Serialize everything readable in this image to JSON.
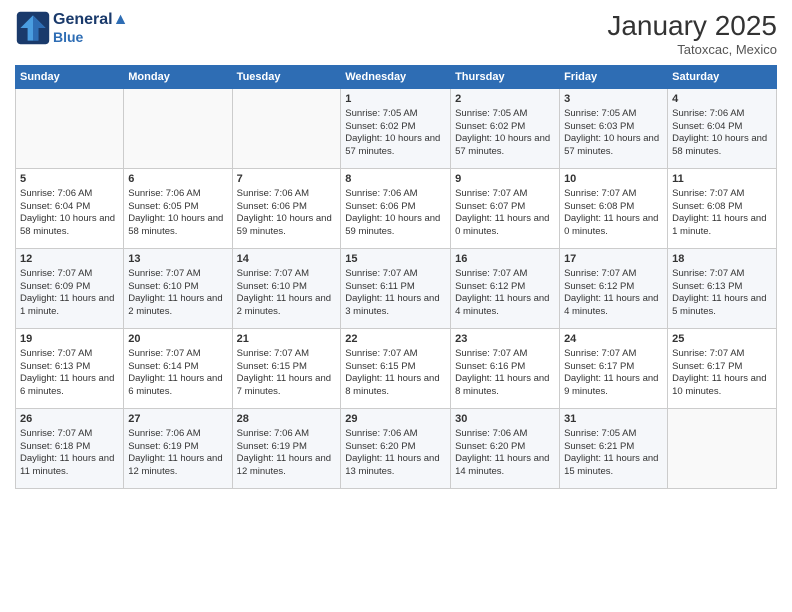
{
  "header": {
    "logo_line1": "General",
    "logo_line2": "Blue",
    "month_title": "January 2025",
    "location": "Tatoxcac, Mexico"
  },
  "weekdays": [
    "Sunday",
    "Monday",
    "Tuesday",
    "Wednesday",
    "Thursday",
    "Friday",
    "Saturday"
  ],
  "weeks": [
    [
      {
        "day": "",
        "info": ""
      },
      {
        "day": "",
        "info": ""
      },
      {
        "day": "",
        "info": ""
      },
      {
        "day": "1",
        "info": "Sunrise: 7:05 AM\nSunset: 6:02 PM\nDaylight: 10 hours and 57 minutes."
      },
      {
        "day": "2",
        "info": "Sunrise: 7:05 AM\nSunset: 6:02 PM\nDaylight: 10 hours and 57 minutes."
      },
      {
        "day": "3",
        "info": "Sunrise: 7:05 AM\nSunset: 6:03 PM\nDaylight: 10 hours and 57 minutes."
      },
      {
        "day": "4",
        "info": "Sunrise: 7:06 AM\nSunset: 6:04 PM\nDaylight: 10 hours and 58 minutes."
      }
    ],
    [
      {
        "day": "5",
        "info": "Sunrise: 7:06 AM\nSunset: 6:04 PM\nDaylight: 10 hours and 58 minutes."
      },
      {
        "day": "6",
        "info": "Sunrise: 7:06 AM\nSunset: 6:05 PM\nDaylight: 10 hours and 58 minutes."
      },
      {
        "day": "7",
        "info": "Sunrise: 7:06 AM\nSunset: 6:06 PM\nDaylight: 10 hours and 59 minutes."
      },
      {
        "day": "8",
        "info": "Sunrise: 7:06 AM\nSunset: 6:06 PM\nDaylight: 10 hours and 59 minutes."
      },
      {
        "day": "9",
        "info": "Sunrise: 7:07 AM\nSunset: 6:07 PM\nDaylight: 11 hours and 0 minutes."
      },
      {
        "day": "10",
        "info": "Sunrise: 7:07 AM\nSunset: 6:08 PM\nDaylight: 11 hours and 0 minutes."
      },
      {
        "day": "11",
        "info": "Sunrise: 7:07 AM\nSunset: 6:08 PM\nDaylight: 11 hours and 1 minute."
      }
    ],
    [
      {
        "day": "12",
        "info": "Sunrise: 7:07 AM\nSunset: 6:09 PM\nDaylight: 11 hours and 1 minute."
      },
      {
        "day": "13",
        "info": "Sunrise: 7:07 AM\nSunset: 6:10 PM\nDaylight: 11 hours and 2 minutes."
      },
      {
        "day": "14",
        "info": "Sunrise: 7:07 AM\nSunset: 6:10 PM\nDaylight: 11 hours and 2 minutes."
      },
      {
        "day": "15",
        "info": "Sunrise: 7:07 AM\nSunset: 6:11 PM\nDaylight: 11 hours and 3 minutes."
      },
      {
        "day": "16",
        "info": "Sunrise: 7:07 AM\nSunset: 6:12 PM\nDaylight: 11 hours and 4 minutes."
      },
      {
        "day": "17",
        "info": "Sunrise: 7:07 AM\nSunset: 6:12 PM\nDaylight: 11 hours and 4 minutes."
      },
      {
        "day": "18",
        "info": "Sunrise: 7:07 AM\nSunset: 6:13 PM\nDaylight: 11 hours and 5 minutes."
      }
    ],
    [
      {
        "day": "19",
        "info": "Sunrise: 7:07 AM\nSunset: 6:13 PM\nDaylight: 11 hours and 6 minutes."
      },
      {
        "day": "20",
        "info": "Sunrise: 7:07 AM\nSunset: 6:14 PM\nDaylight: 11 hours and 6 minutes."
      },
      {
        "day": "21",
        "info": "Sunrise: 7:07 AM\nSunset: 6:15 PM\nDaylight: 11 hours and 7 minutes."
      },
      {
        "day": "22",
        "info": "Sunrise: 7:07 AM\nSunset: 6:15 PM\nDaylight: 11 hours and 8 minutes."
      },
      {
        "day": "23",
        "info": "Sunrise: 7:07 AM\nSunset: 6:16 PM\nDaylight: 11 hours and 8 minutes."
      },
      {
        "day": "24",
        "info": "Sunrise: 7:07 AM\nSunset: 6:17 PM\nDaylight: 11 hours and 9 minutes."
      },
      {
        "day": "25",
        "info": "Sunrise: 7:07 AM\nSunset: 6:17 PM\nDaylight: 11 hours and 10 minutes."
      }
    ],
    [
      {
        "day": "26",
        "info": "Sunrise: 7:07 AM\nSunset: 6:18 PM\nDaylight: 11 hours and 11 minutes."
      },
      {
        "day": "27",
        "info": "Sunrise: 7:06 AM\nSunset: 6:19 PM\nDaylight: 11 hours and 12 minutes."
      },
      {
        "day": "28",
        "info": "Sunrise: 7:06 AM\nSunset: 6:19 PM\nDaylight: 11 hours and 12 minutes."
      },
      {
        "day": "29",
        "info": "Sunrise: 7:06 AM\nSunset: 6:20 PM\nDaylight: 11 hours and 13 minutes."
      },
      {
        "day": "30",
        "info": "Sunrise: 7:06 AM\nSunset: 6:20 PM\nDaylight: 11 hours and 14 minutes."
      },
      {
        "day": "31",
        "info": "Sunrise: 7:05 AM\nSunset: 6:21 PM\nDaylight: 11 hours and 15 minutes."
      },
      {
        "day": "",
        "info": ""
      }
    ]
  ]
}
